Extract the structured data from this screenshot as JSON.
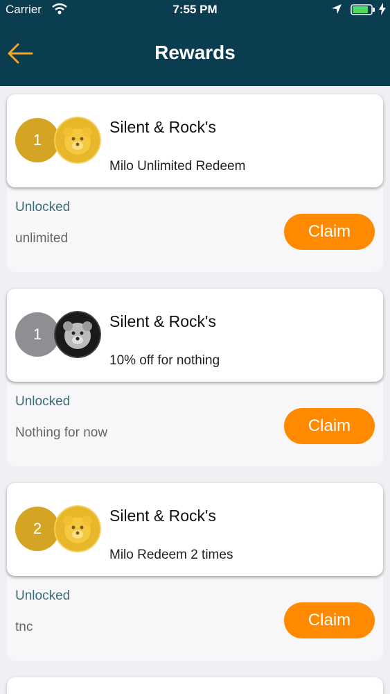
{
  "status_bar": {
    "carrier": "Carrier",
    "time": "7:55 PM"
  },
  "header": {
    "title": "Rewards",
    "back_icon": "arrow-left-icon"
  },
  "colors": {
    "header_bg": "#0b3d51",
    "accent": "#ff8a00",
    "gold": "#d4a424",
    "unlocked_text": "#3d6b7a"
  },
  "rewards": [
    {
      "count": "1",
      "merchant": "Silent & Rock's",
      "title": "Milo Unlimited Redeem",
      "status": "Unlocked",
      "detail": "unlimited",
      "button": "Claim"
    },
    {
      "count": "1",
      "merchant": "Silent & Rock's",
      "title": "10% off for nothing",
      "status": "Unlocked",
      "detail": "Nothing for now",
      "button": "Claim"
    },
    {
      "count": "2",
      "merchant": "Silent & Rock's",
      "title": "Milo Redeem 2 times",
      "status": "Unlocked",
      "detail": "tnc",
      "button": "Claim"
    }
  ]
}
